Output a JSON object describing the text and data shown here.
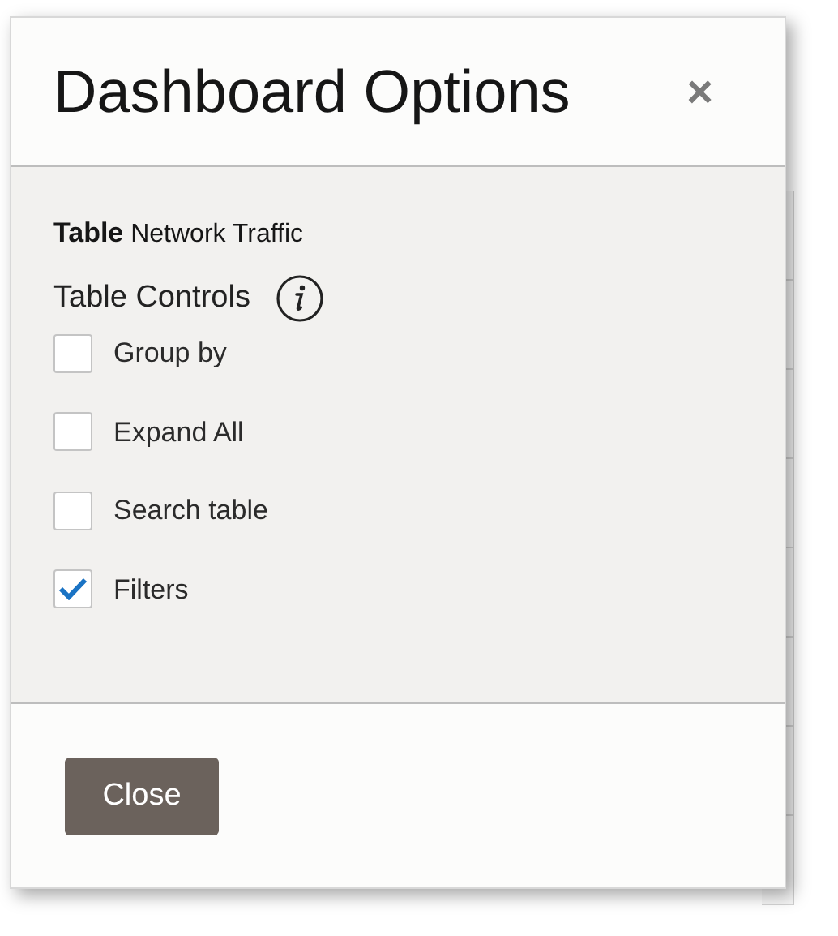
{
  "dialog": {
    "title": "Dashboard Options",
    "close_glyph": "×"
  },
  "table": {
    "label": "Table",
    "name": "Network Traffic"
  },
  "controls_heading": "Table Controls",
  "controls": [
    {
      "label": "Group by",
      "checked": false
    },
    {
      "label": "Expand All",
      "checked": false
    },
    {
      "label": "Search table",
      "checked": false
    },
    {
      "label": "Filters",
      "checked": true
    }
  ],
  "buttons": [
    {
      "label": "Close"
    }
  ]
}
